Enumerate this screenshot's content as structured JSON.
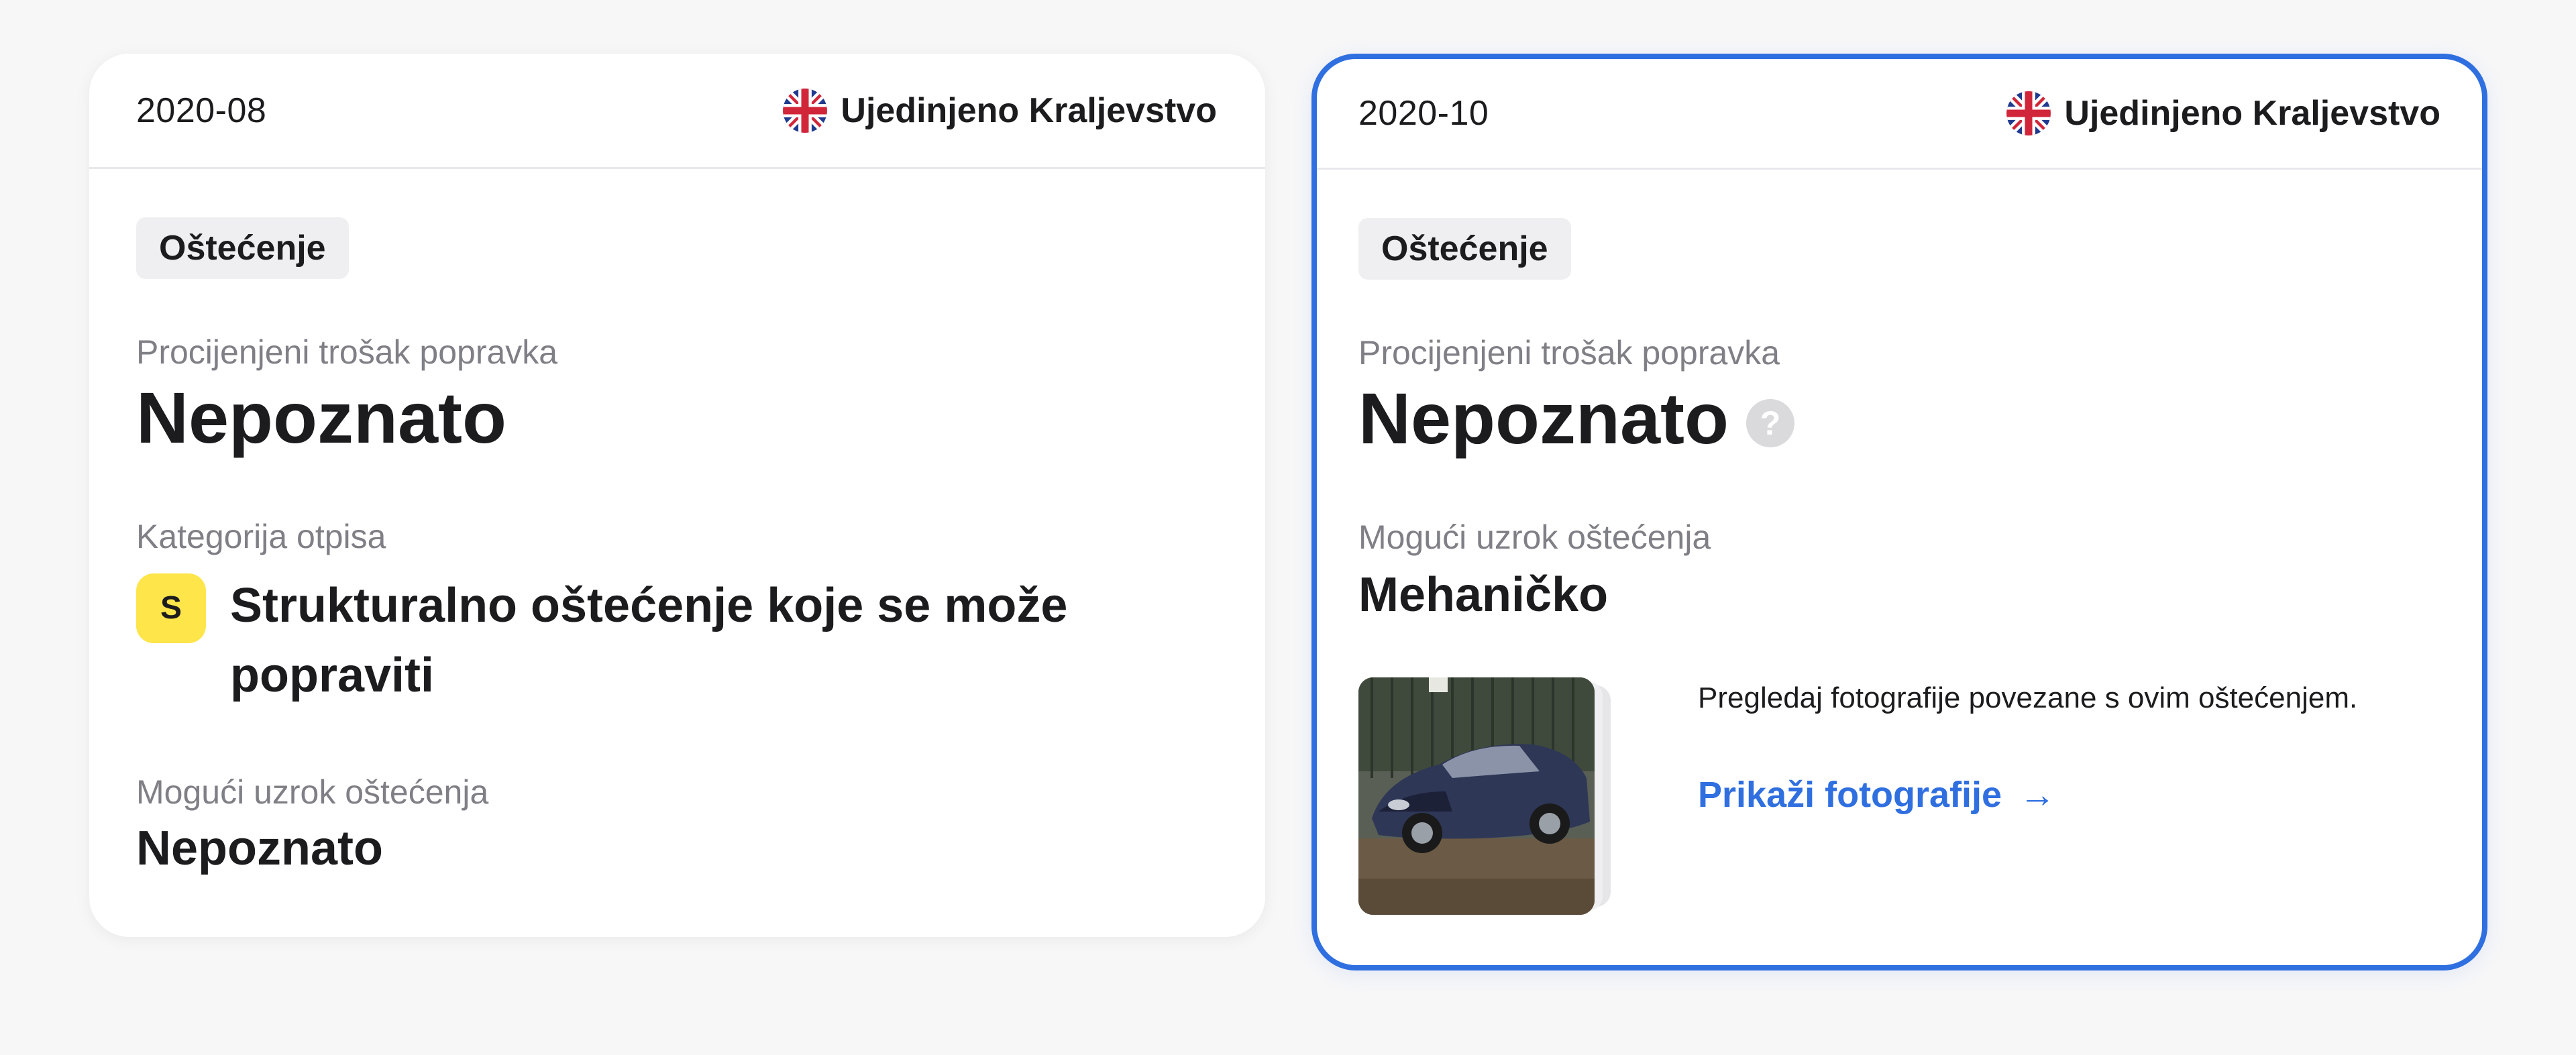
{
  "cards": [
    {
      "date": "2020-08",
      "country": "Ujedinjeno Kraljevstvo",
      "flag_icon": "uk-flag-icon",
      "tag": "Oštećenje",
      "cost_label": "Procijenjeni trošak popravka",
      "cost_value": "Nepoznato",
      "category_label": "Kategorija otpisa",
      "category_badge": "S",
      "category_value": "Strukturalno oštećenje koje se može popraviti",
      "cause_label": "Mogući uzrok oštećenja",
      "cause_value": "Nepoznato"
    },
    {
      "date": "2020-10",
      "country": "Ujedinjeno Kraljevstvo",
      "flag_icon": "uk-flag-icon",
      "tag": "Oštećenje",
      "cost_label": "Procijenjeni trošak popravka",
      "cost_value": "Nepoznato",
      "help_symbol": "?",
      "cause_label": "Mogući uzrok oštećenja",
      "cause_value": "Mehaničko",
      "photos_description": "Pregledaj fotografije povezane s ovim oštećenjem.",
      "photos_link": "Prikaži fotografije",
      "photos_link_arrow": "→"
    }
  ],
  "colors": {
    "accent": "#2f6fe0",
    "category_badge": "#fde54a",
    "tag_background": "#efeff1"
  }
}
